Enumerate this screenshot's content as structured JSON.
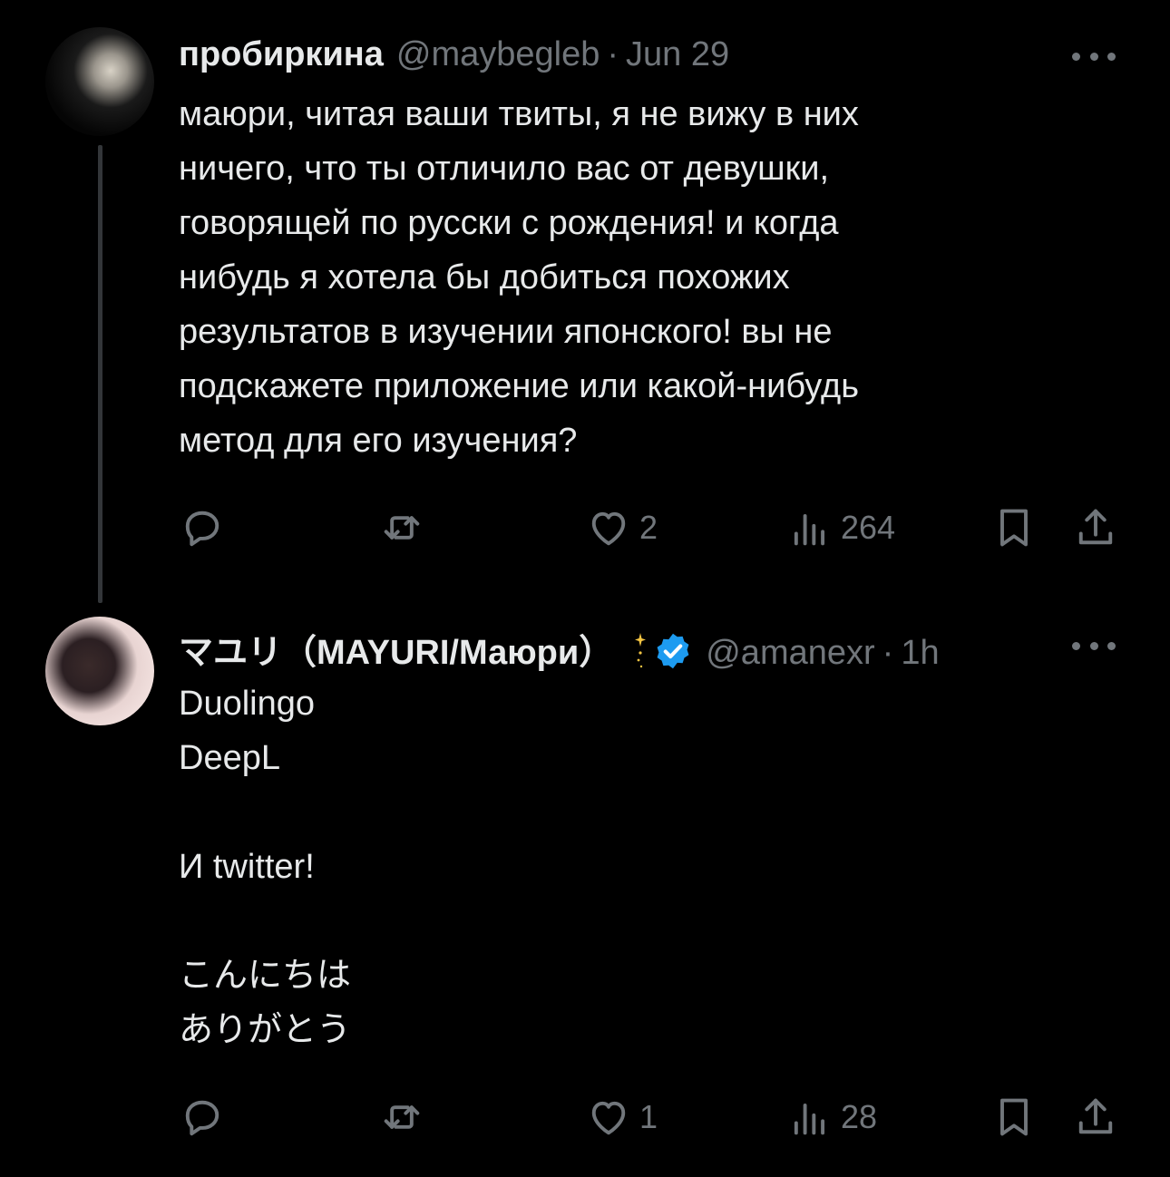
{
  "tweets": [
    {
      "author_name": "пробиркина",
      "handle": "@maybegleb",
      "separator": "·",
      "time": "Jun 29",
      "text_lines": [
        "маюри, читая ваши твиты, я не вижу в них",
        "ничего, что ты отличило вас от девушки,",
        "говорящей по русски с рождения! и когда",
        "нибудь я хотела бы добиться похожих",
        "результатов в изучении японского! вы не",
        "подскажете приложение или какой-нибудь",
        "метод для его изучения?"
      ],
      "actions": {
        "reply_count": "",
        "retweet_count": "",
        "like_count": "2",
        "view_count": "264"
      }
    },
    {
      "author_name": "マユリ（MAYURI/Маюри）",
      "handle": "@amanexr",
      "separator": "·",
      "time": "1h",
      "verified": true,
      "text_lines": [
        "Duolingo",
        "DeepL",
        "",
        "И twitter!",
        "",
        "こんにちは",
        "ありがとう"
      ],
      "actions": {
        "reply_count": "",
        "retweet_count": "",
        "like_count": "1",
        "view_count": "28"
      }
    }
  ],
  "icons": {
    "more": "more-horizontal-icon",
    "reply": "reply-icon",
    "retweet": "retweet-icon",
    "like": "heart-icon",
    "views": "views-icon",
    "bookmark": "bookmark-icon",
    "share": "share-icon",
    "verified": "verified-badge-icon"
  },
  "colors": {
    "background": "#000000",
    "text": "#e7e9ea",
    "secondary": "#71767b",
    "verified": "#1d9bf0",
    "thread_line": "#333639"
  }
}
